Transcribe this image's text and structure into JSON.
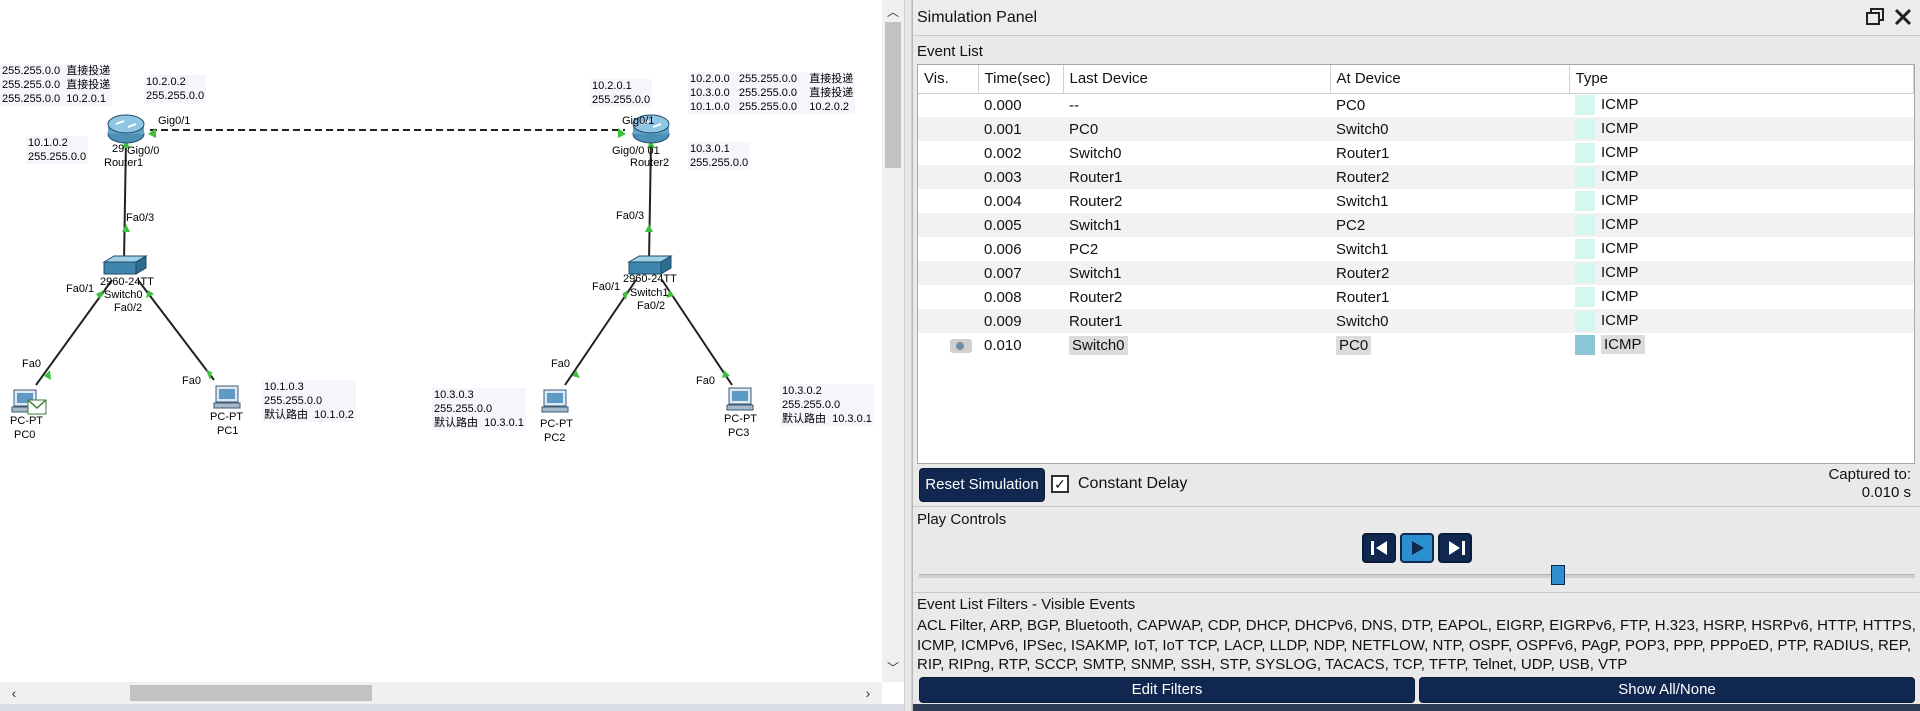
{
  "topology": {
    "routing_tables": {
      "router1_left": "255.255.0.0  直接投递\n255.255.0.0  直接投递\n255.255.0.0  10.2.0.1",
      "router2_right": "10.2.0.0   255.255.0.0    直接投递\n10.3.0.0   255.255.0.0    直接投递\n10.1.0.0   255.255.0.0    10.2.0.2"
    },
    "addresses": {
      "r1_gig": "10.2.0.2\n255.255.0.0",
      "r1_fa": "10.1.0.2\n255.255.0.0",
      "r2_gig": "10.2.0.1\n255.255.0.0",
      "r2_fa": "10.3.0.1\n255.255.0.0",
      "pc1": "10.1.0.3\n255.255.0.0\n默认路由  10.1.0.2",
      "pc2": "10.3.0.3\n255.255.0.0\n默认路由  10.3.0.1",
      "pc3": "10.3.0.2\n255.255.0.0\n默认路由  10.3.0.1"
    },
    "port_labels": {
      "r1_gig01": "Gig0/1",
      "r1_gig00": "Gig0/0",
      "r1_fa03": "Fa0/3",
      "r2_gig01": "Gig0/1",
      "r2_gig00": "Gig0/0 01",
      "r2_fa03": "Fa0/3",
      "sw0_fa01": "Fa0/1",
      "sw0_fa02": "Fa0/2",
      "sw1_fa01": "Fa0/1",
      "sw1_fa02": "Fa0/2",
      "pc0_fa0": "Fa0",
      "pc1_fa0": "Fa0",
      "pc2_fa0": "Fa0",
      "pc3_fa0": "Fa0"
    },
    "devices": {
      "router1": {
        "model": "29",
        "name": "Router1"
      },
      "router2": {
        "model": "",
        "name": "Router2"
      },
      "switch0": {
        "model": "2960-24TT",
        "name": "Switch0"
      },
      "switch1": {
        "model": "2960-24TT",
        "name": "Switch1"
      },
      "pc0": {
        "model": "PC-PT",
        "name": "PC0"
      },
      "pc1": {
        "model": "PC-PT",
        "name": "PC1"
      },
      "pc2": {
        "model": "PC-PT",
        "name": "PC2"
      },
      "pc3": {
        "model": "PC-PT",
        "name": "PC3"
      }
    }
  },
  "panel": {
    "title": "Simulation Panel",
    "event_list_label": "Event List",
    "columns": [
      "Vis.",
      "Time(sec)",
      "Last Device",
      "At Device",
      "Type"
    ],
    "events": [
      {
        "time": "0.000",
        "last": "--",
        "at": "PC0",
        "type": "ICMP"
      },
      {
        "time": "0.001",
        "last": "PC0",
        "at": "Switch0",
        "type": "ICMP"
      },
      {
        "time": "0.002",
        "last": "Switch0",
        "at": "Router1",
        "type": "ICMP"
      },
      {
        "time": "0.003",
        "last": "Router1",
        "at": "Router2",
        "type": "ICMP"
      },
      {
        "time": "0.004",
        "last": "Router2",
        "at": "Switch1",
        "type": "ICMP"
      },
      {
        "time": "0.005",
        "last": "Switch1",
        "at": "PC2",
        "type": "ICMP"
      },
      {
        "time": "0.006",
        "last": "PC2",
        "at": "Switch1",
        "type": "ICMP"
      },
      {
        "time": "0.007",
        "last": "Switch1",
        "at": "Router2",
        "type": "ICMP"
      },
      {
        "time": "0.008",
        "last": "Router2",
        "at": "Router1",
        "type": "ICMP"
      },
      {
        "time": "0.009",
        "last": "Router1",
        "at": "Switch0",
        "type": "ICMP"
      },
      {
        "time": "0.010",
        "last": "Switch0",
        "at": "PC0",
        "type": "ICMP"
      }
    ],
    "reset_label": "Reset Simulation",
    "constant_delay_label": "Constant Delay",
    "constant_delay_checked": true,
    "captured_label": "Captured to:",
    "captured_value": "0.010 s",
    "play_controls_label": "Play Controls",
    "slider_position": 0.642,
    "filters_label": "Event List Filters - Visible Events",
    "filters_text": "ACL Filter, ARP, BGP, Bluetooth, CAPWAP, CDP, DHCP, DHCPv6, DNS, DTP, EAPOL, EIGRP, EIGRPv6, FTP, H.323, HSRP, HSRPv6, HTTP, HTTPS, ICMP, ICMPv6, IPSec, ISAKMP, IoT, IoT TCP, LACP, LLDP, NDP, NETFLOW, NTP, OSPF, OSPFv6, PAgP, POP3, PPP, PPPoED, PTP, RADIUS, REP, RIP, RIPng, RTP, SCCP, SMTP, SNMP, SSH, STP, SYSLOG, TACACS, TCP, TFTP, Telnet, UDP, USB, VTP",
    "edit_filters_label": "Edit Filters",
    "show_all_label": "Show All/None",
    "colors": {
      "navy": "#10284f",
      "icmp_swatch": "#d6f7ef",
      "play_blue": "#2d8ed0"
    }
  }
}
